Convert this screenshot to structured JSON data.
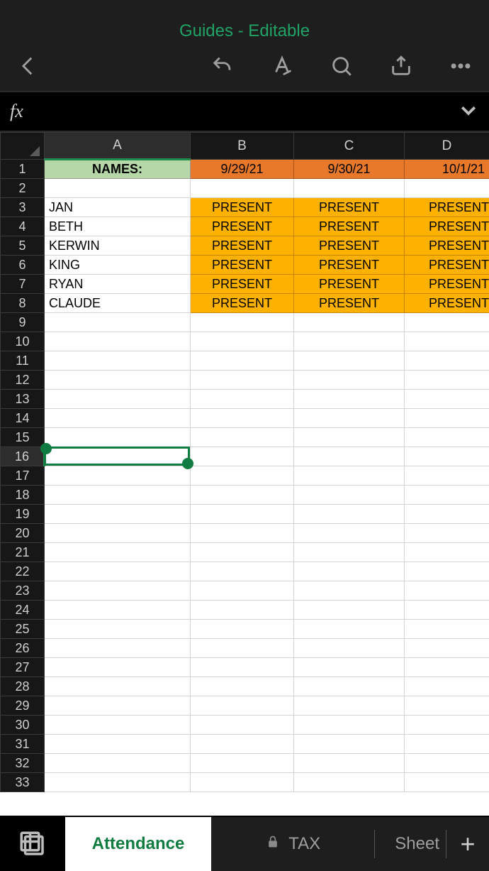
{
  "title": "Guides - Editable",
  "formula_label": "fx",
  "formula_value": "",
  "columns": [
    "A",
    "B",
    "C",
    "D"
  ],
  "active_column": "A",
  "active_row": 16,
  "visible_rows": 33,
  "header_row": {
    "names_label": "NAMES:",
    "dates": [
      "9/29/21",
      "9/30/21",
      "10/1/21"
    ]
  },
  "data_rows": [
    {
      "name": "JAN",
      "status": [
        "PRESENT",
        "PRESENT",
        "PRESENT"
      ]
    },
    {
      "name": "BETH",
      "status": [
        "PRESENT",
        "PRESENT",
        "PRESENT"
      ]
    },
    {
      "name": "KERWIN",
      "status": [
        "PRESENT",
        "PRESENT",
        "PRESENT"
      ]
    },
    {
      "name": "KING",
      "status": [
        "PRESENT",
        "PRESENT",
        "PRESENT"
      ]
    },
    {
      "name": "RYAN",
      "status": [
        "PRESENT",
        "PRESENT",
        "PRESENT"
      ]
    },
    {
      "name": "CLAUDE",
      "status": [
        "PRESENT",
        "PRESENT",
        "PRESENT"
      ]
    }
  ],
  "selection": {
    "cell": "A16"
  },
  "tabs": {
    "active": "Attendance",
    "locked": "TAX",
    "third": "Sheet"
  }
}
